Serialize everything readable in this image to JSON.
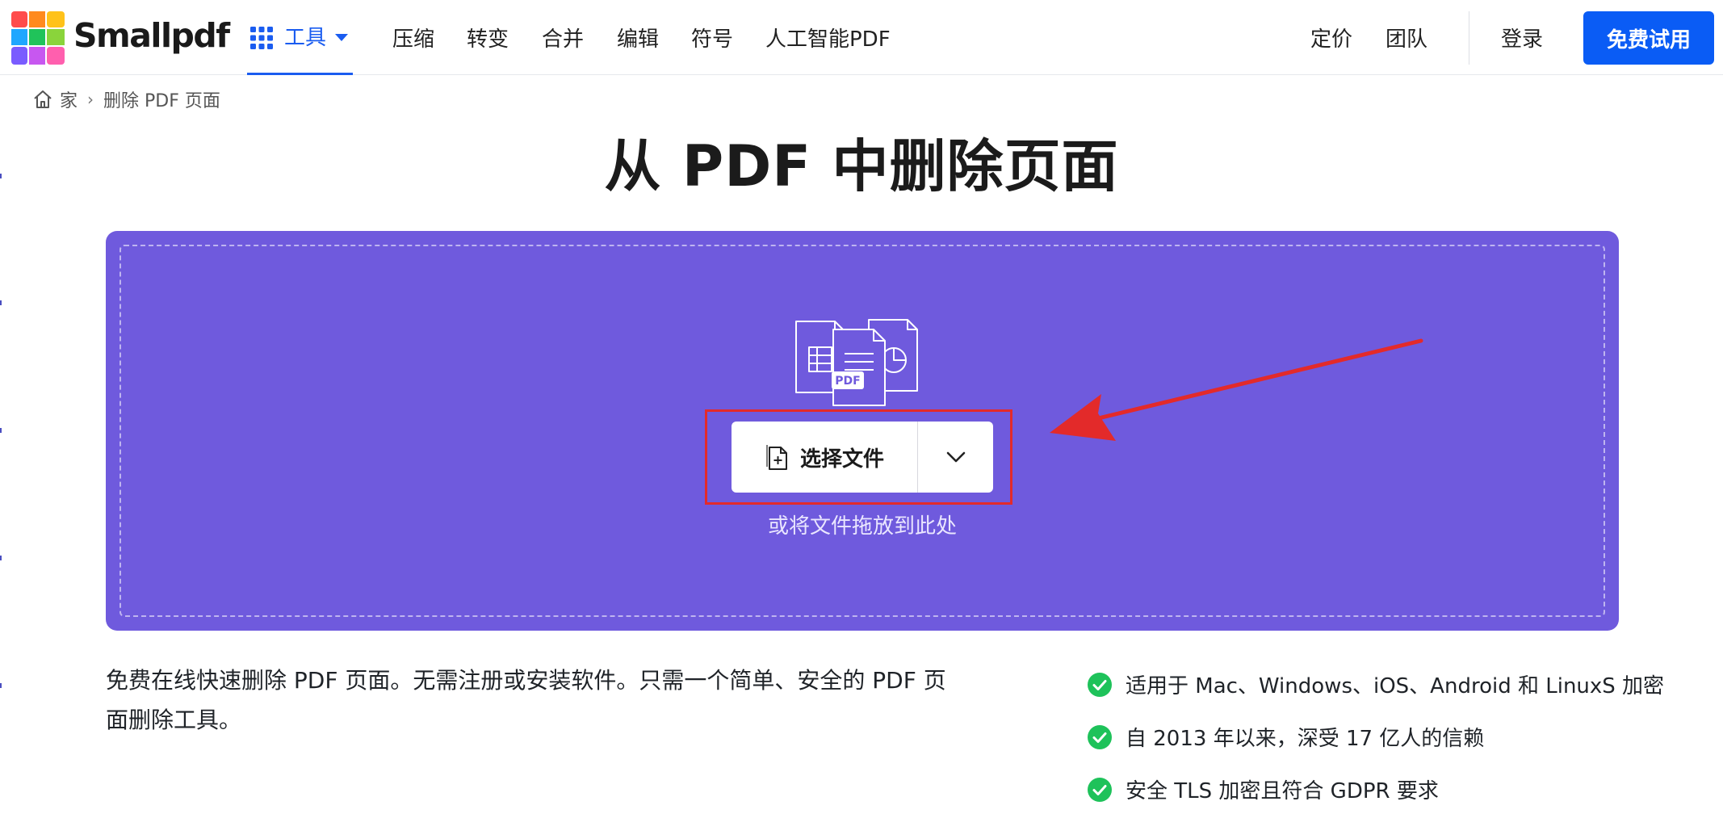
{
  "header": {
    "brand": "Smallpdf",
    "tools_label": "工具",
    "nav": [
      "压缩",
      "转变",
      "合并",
      "编辑",
      "符号",
      "人工智能PDF"
    ],
    "pricing": "定价",
    "team": "团队",
    "login": "登录",
    "trial": "免费试用"
  },
  "breadcrumb": {
    "home": "家",
    "separator": "›",
    "current": "删除 PDF 页面"
  },
  "page": {
    "title": "从 PDF 中删除页面"
  },
  "dropzone": {
    "doc_badge": "PDF",
    "select_button": "选择文件",
    "drop_hint": "或将文件拖放到此处"
  },
  "description": "免费在线快速删除 PDF 页面。无需注册或安装软件。只需一个简单、安全的 PDF 页面删除工具。",
  "features": [
    "适用于 Mac、Windows、iOS、Android 和 LinuxS 加密",
    "自 2013 年以来，深受 17 亿人的信赖",
    "安全 TLS 加密且符合 GDPR 要求"
  ],
  "colors": {
    "accent": "#0a5cf5",
    "dropzone": "#6f5add",
    "annotation": "#e32a2a",
    "check": "#1ec25a"
  },
  "icons": [
    "smallpdf-logo",
    "grid-icon",
    "caret-down-icon",
    "home-icon",
    "document-stack-icon",
    "file-add-icon",
    "chevron-down-icon",
    "check-circle-icon",
    "arrow-annotation"
  ]
}
